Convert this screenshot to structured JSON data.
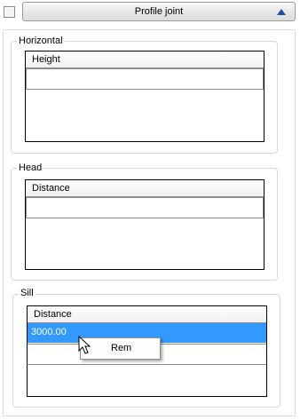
{
  "header": {
    "title": "Profile joint",
    "collapse_icon": "triangle-up-icon",
    "checkbox_checked": false
  },
  "sections": [
    {
      "title": "Horizontal",
      "column": "Height",
      "rows": []
    },
    {
      "title": "Head",
      "column": "Distance",
      "rows": []
    },
    {
      "title": "Sill",
      "column": "Distance",
      "rows": [
        "3000.00"
      ]
    }
  ],
  "context_menu": {
    "items": [
      "Rem"
    ]
  },
  "colors": {
    "selection": "#3399ff",
    "accent_icon": "#1f4fa0"
  }
}
